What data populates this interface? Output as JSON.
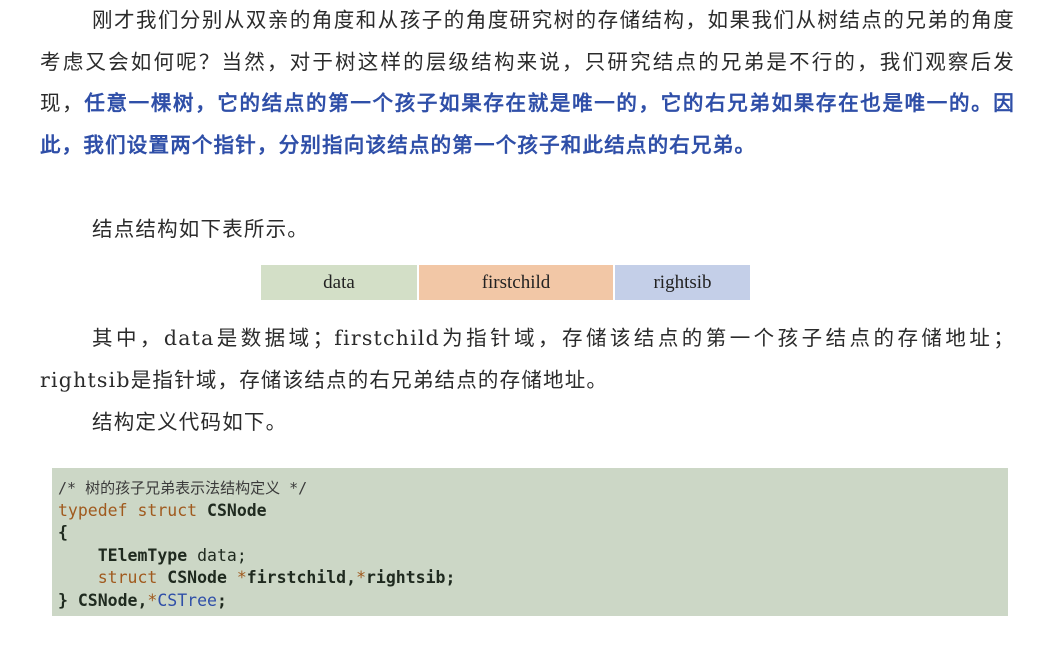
{
  "paragraph1": {
    "normal": "刚才我们分别从双亲的角度和从孩子的角度研究树的存储结构，如果我们从树结点的兄弟的角度考虑又会如何呢？当然，对于树这样的层级结构来说，只研究结点的兄弟是不行的，我们观察后发现，",
    "emphasis": "任意一棵树，它的结点的第一个孩子如果存在就是唯一的，它的右兄弟如果存在也是唯一的。因此，我们设置两个指针，分别指向该结点的第一个孩子和此结点的右兄弟。"
  },
  "paragraph2": "结点结构如下表所示。",
  "node_table": {
    "data": "data",
    "firstchild": "firstchild",
    "rightsib": "rightsib"
  },
  "paragraph3": "其中，data是数据域；firstchild为指针域，存储该结点的第一个孩子结点的存储地址；rightsib是指针域，存储该结点的右兄弟结点的存储地址。",
  "paragraph4": "结构定义代码如下。",
  "code": {
    "comment": "/* 树的孩子兄弟表示法结构定义 */",
    "line2_kw": "typedef struct",
    "line2_name": " CSNode",
    "line3": "{",
    "line4_indent": "    ",
    "line4_type": "TElemType",
    "line4_rest": " data;",
    "line5_indent": "    ",
    "line5_kw": "struct",
    "line5_type": " CSNode ",
    "line5_ptr1": "*",
    "line5_f1": "firstchild,",
    "line5_ptr2": "*",
    "line5_f2": "rightsib;",
    "line6_open": "} CSNode,",
    "line6_ptr": "*",
    "line6_name": "CSTree",
    "line6_end": ";"
  },
  "colors": {
    "emphasis": "#2f4fa8",
    "code_bg": "#ccd7c6",
    "cell_data": "#d3dfc7",
    "cell_firstchild": "#f2c7a6",
    "cell_rightsib": "#c4cfe8",
    "keyword": "#a05a1e"
  }
}
